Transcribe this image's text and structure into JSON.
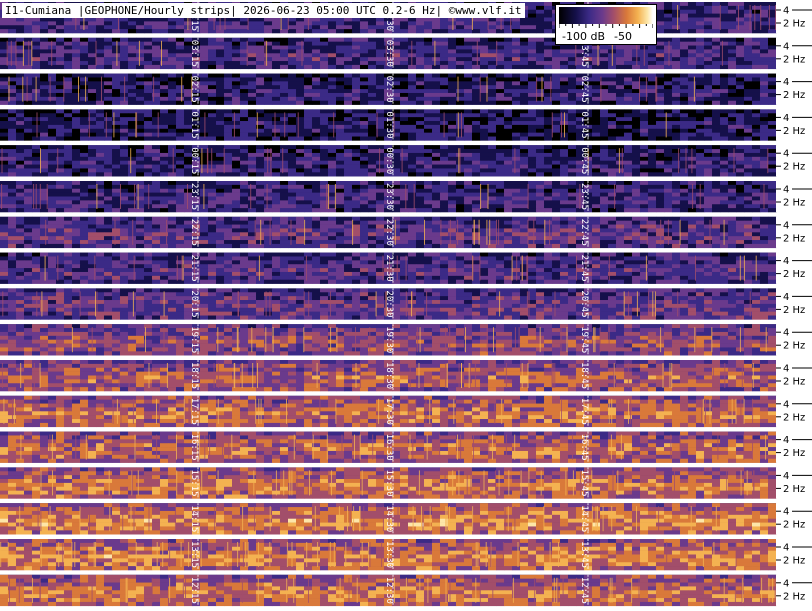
{
  "title": "I1-Cumiana |GEOPHONE/Hourly strips| 2026-06-23 05:00 UTC 0.2-6 Hz| ©www.vlf.it",
  "colorbar": {
    "labels": [
      "-100 dB",
      "-50"
    ],
    "min_db": -110,
    "max_db": -40
  },
  "palette": [
    "#000000",
    "#15104a",
    "#3b2a86",
    "#6a3a8c",
    "#a24e6a",
    "#d9793a",
    "#f4b251",
    "#fde6a8"
  ],
  "chart_data": {
    "type": "heatmap",
    "freq_unit": "Hz",
    "freq_range": [
      0.2,
      6
    ],
    "freq_tick_labels": [
      "4",
      "2 Hz"
    ],
    "strips": [
      {
        "hour": "04",
        "markers": [
          "04:15",
          "04:30",
          "04:45"
        ],
        "intensity": 0.3
      },
      {
        "hour": "03",
        "markers": [
          "03:15",
          "03:30",
          "03:45"
        ],
        "intensity": 0.32
      },
      {
        "hour": "02",
        "markers": [
          "02:15",
          "02:30",
          "02:45"
        ],
        "intensity": 0.25
      },
      {
        "hour": "01",
        "markers": [
          "01:15",
          "01:30",
          "01:45"
        ],
        "intensity": 0.22
      },
      {
        "hour": "00",
        "markers": [
          "00:15",
          "00:30",
          "00:45"
        ],
        "intensity": 0.26
      },
      {
        "hour": "23",
        "markers": [
          "23:15",
          "23:30",
          "23:45"
        ],
        "intensity": 0.3
      },
      {
        "hour": "22",
        "markers": [
          "22:15",
          "22:30",
          "22:45"
        ],
        "intensity": 0.38
      },
      {
        "hour": "21",
        "markers": [
          "21:15",
          "21:30",
          "21:45"
        ],
        "intensity": 0.35
      },
      {
        "hour": "20",
        "markers": [
          "20:15",
          "20:30",
          "20:45"
        ],
        "intensity": 0.4
      },
      {
        "hour": "19",
        "markers": [
          "19:15",
          "19:30",
          "19:45"
        ],
        "intensity": 0.5
      },
      {
        "hour": "18",
        "markers": [
          "18:15",
          "18:30",
          "18:45"
        ],
        "intensity": 0.56
      },
      {
        "hour": "17",
        "markers": [
          "17:15",
          "17:30",
          "17:45"
        ],
        "intensity": 0.62
      },
      {
        "hour": "16",
        "markers": [
          "16:15",
          "16:30",
          "16:45"
        ],
        "intensity": 0.6
      },
      {
        "hour": "15",
        "markers": [
          "15:15",
          "15:30",
          "15:45"
        ],
        "intensity": 0.64
      },
      {
        "hour": "14",
        "markers": [
          "14:15",
          "14:30",
          "14:45"
        ],
        "intensity": 0.68
      },
      {
        "hour": "13",
        "markers": [
          "13:15",
          "13:30",
          "13:45"
        ],
        "intensity": 0.66
      },
      {
        "hour": "12",
        "markers": [
          "12:15",
          "12:30",
          "12:45"
        ],
        "intensity": 0.64
      }
    ]
  }
}
